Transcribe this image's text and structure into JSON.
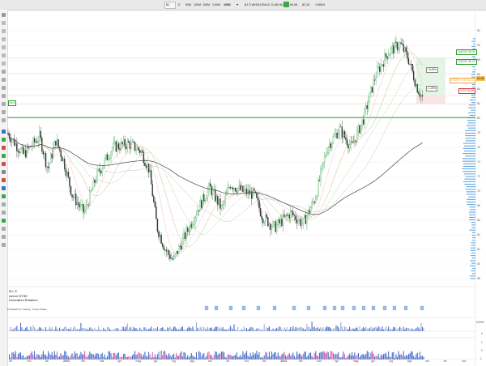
{
  "top_bar": {
    "symbol": "BJ",
    "interval": "D",
    "tabs": [
      "50M",
      "100M",
      "150M",
      "2.60M",
      "100D"
    ],
    "active_tab": "100D",
    "title": "BJ S WHOLESALE CLUB HLD",
    "price_a": "84,08",
    "price_b": "82,16",
    "change": "1,966%"
  },
  "chart_info": {
    "line1": "BJ, D",
    "line2": "Azioni NYSE",
    "line3": "Diversified Retailers",
    "indicator_label": "ProRealTime Trading - Tempo Reale"
  },
  "price_axis": [
    "92",
    "90",
    "88",
    "86",
    "84",
    "82",
    "80",
    "78",
    "76",
    "74",
    "72",
    "70",
    "68",
    "66",
    "64",
    "62",
    "60",
    "58"
  ],
  "price_tag": "84,06",
  "levels": {
    "target1": "TARGET 88,30",
    "target2": "TARGET 86,23",
    "entry": "ENTRY LOW 83,12",
    "stop": "STOP 81,96",
    "pct_up": "+5,49%",
    "pct_down": "-1,25%",
    "box_label": "BOX",
    "entry_color": "#f0a030",
    "stop_color": "#e03030",
    "target_color": "#2a9a2a"
  },
  "time_axis": [
    "ott",
    "nov",
    "dic",
    "2023",
    "feb",
    "mar",
    "apr",
    "mag",
    "giu",
    "lug",
    "ago",
    "set",
    "ott",
    "nov",
    "dic",
    "2024",
    "feb",
    "mar",
    "apr",
    "mag",
    "giu",
    "lug",
    "ago",
    "set",
    "ott",
    "nov"
  ],
  "volume_axis": {
    "top": "6.000k",
    "bottom": "0"
  },
  "osc_axis": [
    "1",
    "0",
    "-1"
  ],
  "chart_data": {
    "type": "line",
    "title": "",
    "series": [
      {
        "name": "",
        "values": []
      }
    ],
    "ylim": [
      57,
      93
    ],
    "x_tick_labels": [
      "ott",
      "nov",
      "dic",
      "2023",
      "feb",
      "mar",
      "apr",
      "mag",
      "giu",
      "lug",
      "ago",
      "set",
      "ott",
      "nov",
      "dic",
      "2024",
      "feb",
      "mar",
      "apr",
      "mag",
      "giu",
      "lug",
      "ago",
      "set",
      "ott",
      "nov"
    ],
    "y_tick_labels": [
      "92",
      "90",
      "88",
      "86",
      "84",
      "82",
      "80",
      "78",
      "76",
      "74",
      "72",
      "70",
      "68",
      "66",
      "64",
      "62",
      "60",
      "58"
    ]
  }
}
